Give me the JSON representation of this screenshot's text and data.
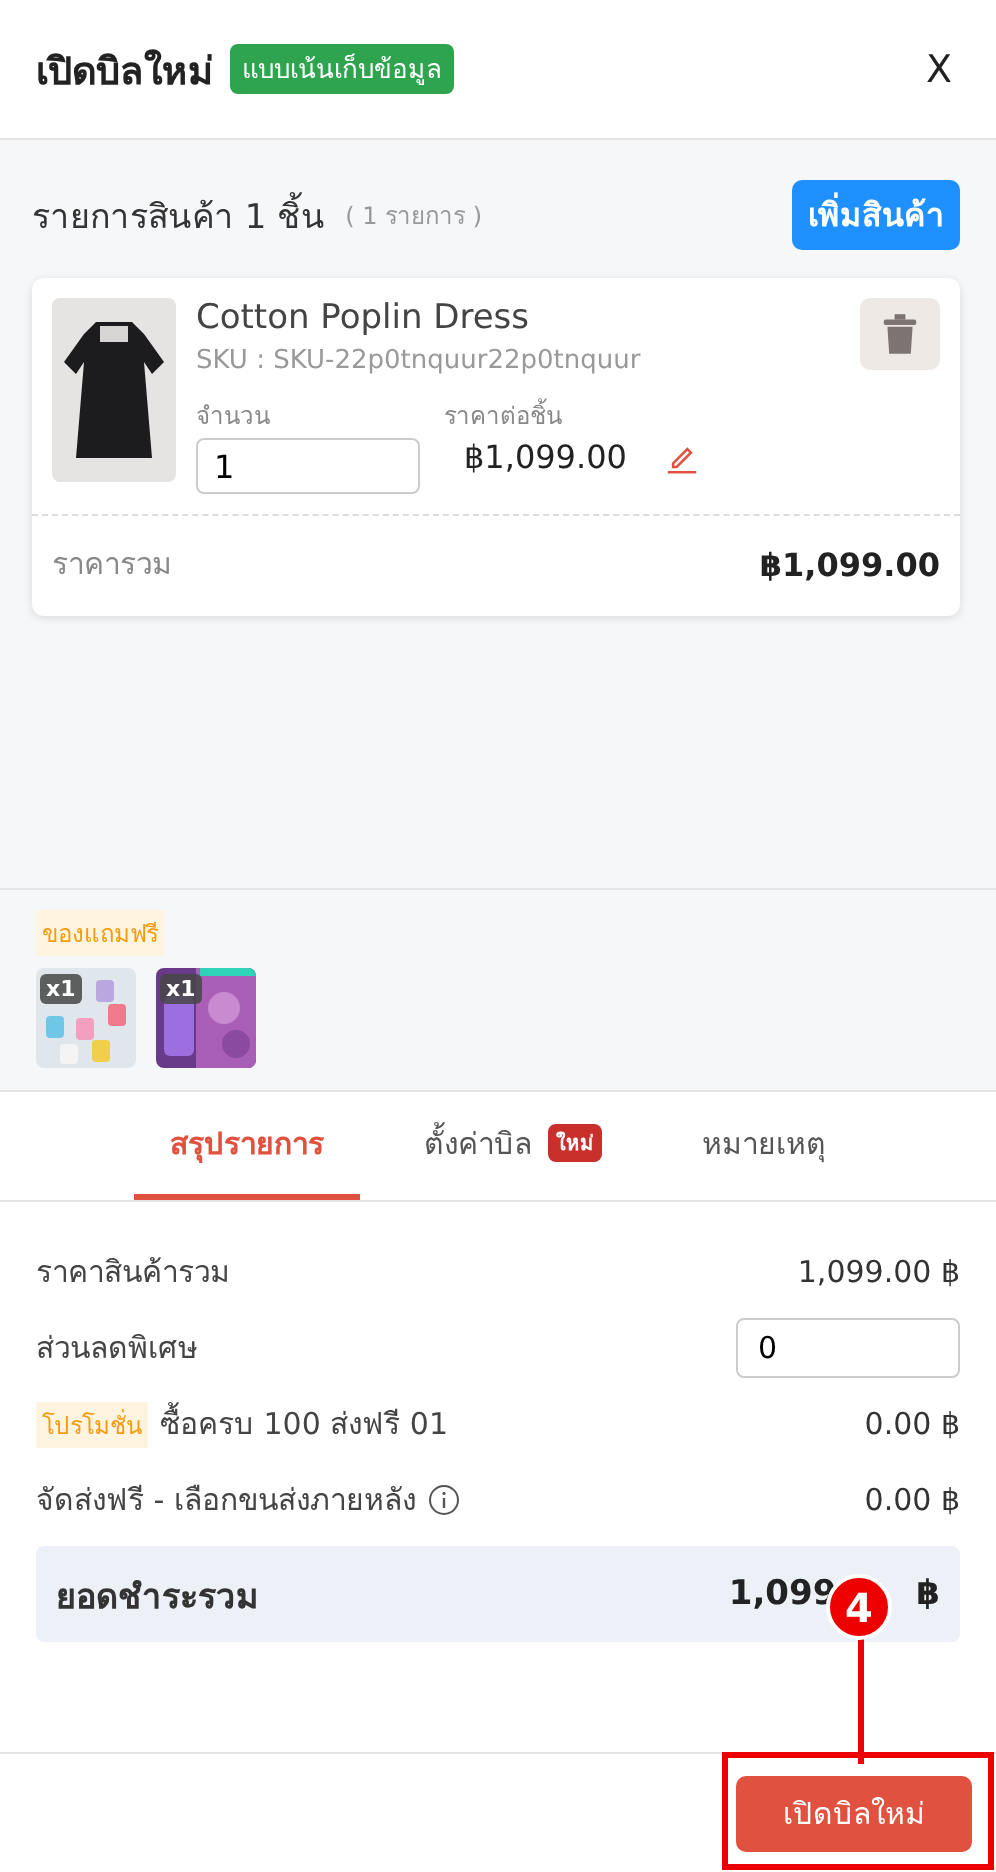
{
  "header": {
    "title": "เปิดบิลใหม่",
    "tag": "แบบเน้นเก็บข้อมูล",
    "close": "X"
  },
  "items_section": {
    "title": "รายการสินค้า 1 ชิ้น",
    "count": "( 1 รายการ )",
    "add_button": "เพิ่มสินค้า"
  },
  "products": [
    {
      "name": "Cotton Poplin Dress",
      "sku": "SKU : SKU-22p0tnquur22p0tnquur",
      "qty_label": "จำนวน",
      "qty": "1",
      "price_label": "ราคาต่อชิ้น",
      "price": "฿1,099.00",
      "total_label": "ราคารวม",
      "total": "฿1,099.00"
    }
  ],
  "gifts": {
    "label": "ของแถมฟรี",
    "items": [
      {
        "qty": "x1",
        "kind": "picture"
      },
      {
        "qty": "x1",
        "kind": "picture"
      }
    ]
  },
  "tabs": [
    {
      "label": "สรุปรายการ",
      "selected": true
    },
    {
      "label": "ตั้งค่าบิล",
      "selected": false,
      "badge": "ใหม่"
    },
    {
      "label": "หมายเหตุ",
      "selected": false
    }
  ],
  "summary": [
    {
      "kind": "text",
      "label": "ราคาสินค้ารวม",
      "value": "1,099.00 ฿"
    },
    {
      "kind": "input",
      "label": "ส่วนลดพิเศษ",
      "value": "0"
    },
    {
      "kind": "promo",
      "tag": "โปรโมชั่น",
      "label": "ซื้อครบ 100 ส่งฟรี 01",
      "value": "0.00 ฿"
    },
    {
      "kind": "info",
      "label": "จัดส่งฟรี - เลือกขนส่งภายหลัง",
      "value": "0.00 ฿"
    }
  ],
  "grand_total": {
    "label": "ยอดชำระรวม",
    "value": "1,099",
    "currency": "฿"
  },
  "submit_button": "เปิดบิลใหม่",
  "annotation": {
    "step": "4"
  }
}
